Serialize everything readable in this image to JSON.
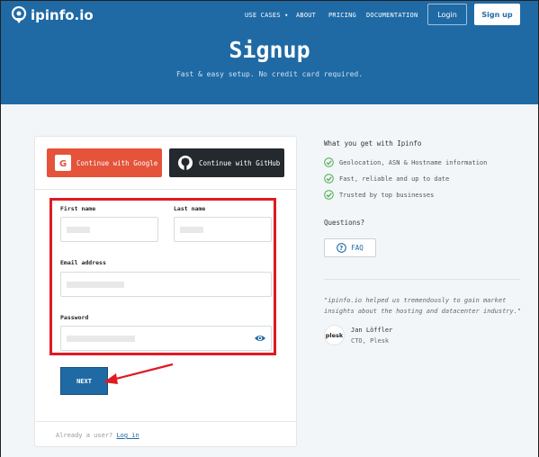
{
  "header": {
    "logo_text": "ipinfo.io",
    "nav": {
      "use_cases": "USE CASES",
      "about": "ABOUT",
      "pricing": "PRICING",
      "documentation": "DOCUMENTATION"
    },
    "login_label": "Login",
    "signup_label": "Sign up"
  },
  "hero": {
    "title": "Signup",
    "subtitle": "Fast & easy setup. No credit card required."
  },
  "form": {
    "google_label": "Continue with Google",
    "github_label": "Continue with GitHub",
    "first_name_label": "First name",
    "last_name_label": "Last name",
    "email_label": "Email address",
    "password_label": "Password",
    "next_label": "NEXT",
    "footer_text": "Already a user?",
    "footer_link": "Log in"
  },
  "sidebar": {
    "benefits_title": "What you get with Ipinfo",
    "benefits": [
      "Geolocation, ASN & Hostname information",
      "Fast, reliable and up to date",
      "Trusted by top businesses"
    ],
    "questions_title": "Questions?",
    "faq_label": "FAQ",
    "testimonial": {
      "quote": "\"ipinfo.io helped us tremendously to gain market insights about the hosting and datacenter industry.\"",
      "avatar_text": "plesk",
      "name": "Jan Löffler",
      "role": "CTO, Plesk"
    }
  },
  "colors": {
    "brand_blue": "#1f6aa5",
    "google_red": "#e4533a",
    "github_dark": "#24292e",
    "highlight_red": "#e01a22",
    "check_green": "#4caf50"
  }
}
